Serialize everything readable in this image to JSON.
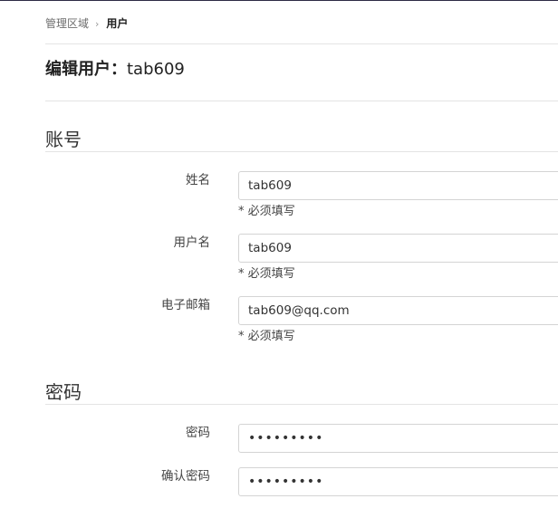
{
  "breadcrumb": {
    "root": "管理区域",
    "separator": "›",
    "current": "用户"
  },
  "page_title": {
    "prefix": "编辑用户：",
    "username": "tab609"
  },
  "sections": {
    "account": {
      "title": "账号",
      "name_label": "姓名",
      "name_value": "tab609",
      "name_hint": "* 必须填写",
      "username_label": "用户名",
      "username_value": "tab609",
      "username_hint": "* 必须填写",
      "email_label": "电子邮箱",
      "email_value": "tab609@qq.com",
      "email_hint": "* 必须填写"
    },
    "password": {
      "title": "密码",
      "password_label": "密码",
      "password_value": "•••••••••",
      "confirm_label": "确认密码",
      "confirm_value": "•••••••••"
    }
  }
}
